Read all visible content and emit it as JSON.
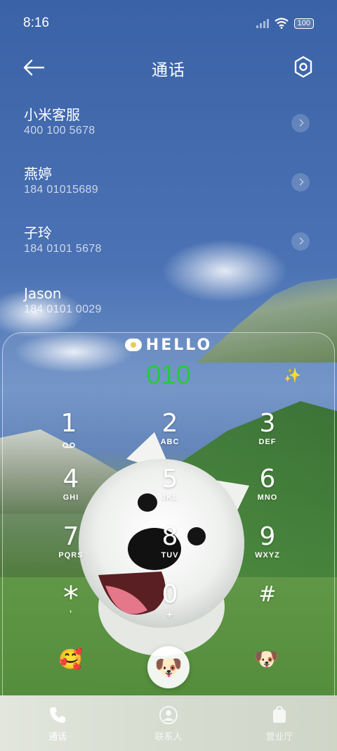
{
  "status": {
    "time": "8:16",
    "battery": "100"
  },
  "header": {
    "title": "通话"
  },
  "recents": [
    {
      "name": "小米客服",
      "number": "400 100 5678"
    },
    {
      "name": "燕婷",
      "number": "184 01015689"
    },
    {
      "name": "子玲",
      "number": "184 0101 5678"
    },
    {
      "name": "Jason",
      "number": "184 0101 0029"
    }
  ],
  "dialer": {
    "banner": "HELLO",
    "input": "010",
    "keys": [
      {
        "digit": "1",
        "letters": ""
      },
      {
        "digit": "2",
        "letters": "ABC"
      },
      {
        "digit": "3",
        "letters": "DEF"
      },
      {
        "digit": "4",
        "letters": "GHI"
      },
      {
        "digit": "5",
        "letters": "JKL"
      },
      {
        "digit": "6",
        "letters": "MNO"
      },
      {
        "digit": "7",
        "letters": "PQRS"
      },
      {
        "digit": "8",
        "letters": "TUV"
      },
      {
        "digit": "9",
        "letters": "WXYZ"
      },
      {
        "digit": "*",
        "letters": ","
      },
      {
        "digit": "0",
        "letters": "+"
      },
      {
        "digit": "#",
        "letters": ""
      }
    ],
    "left_emoji": "🥰",
    "right_emoji": "🐶",
    "call_emoji": "🐶"
  },
  "nav": {
    "calls": "通话",
    "contacts": "联系人",
    "store": "营业厅"
  },
  "colors": {
    "dial_number": "#27c93f",
    "accent_sky": "#3a62a6"
  }
}
